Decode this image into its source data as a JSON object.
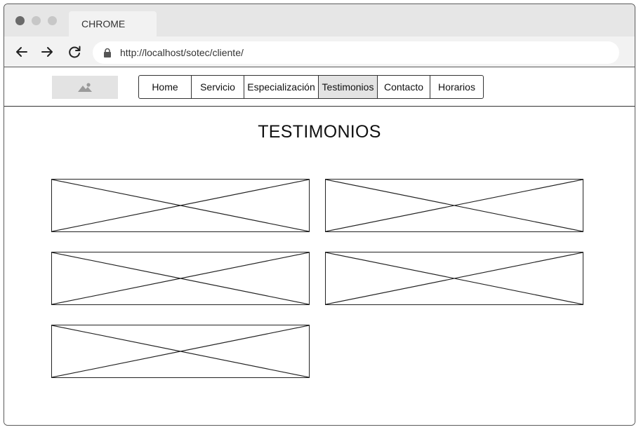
{
  "browser": {
    "tab_title": "CHROME",
    "url": "http://localhost/sotec/cliente/",
    "icons": {
      "back": "arrow-left-icon",
      "forward": "arrow-right-icon",
      "reload": "reload-icon",
      "lock": "lock-icon"
    }
  },
  "site": {
    "logo": "image-placeholder-icon",
    "menu": [
      {
        "label": "Home",
        "active": false
      },
      {
        "label": "Servicio",
        "active": false
      },
      {
        "label": "Especialización",
        "active": false
      },
      {
        "label": "Testimonios",
        "active": true
      },
      {
        "label": "Contacto",
        "active": false
      },
      {
        "label": "Horarios",
        "active": false
      }
    ]
  },
  "main": {
    "title": "TESTIMONIOS",
    "testimonial_count": 5
  },
  "colors": {
    "titlebar": "#e6e6e6",
    "toolbar": "#f2f2f2",
    "active_menu": "#e3e3e3",
    "border": "#333333"
  }
}
